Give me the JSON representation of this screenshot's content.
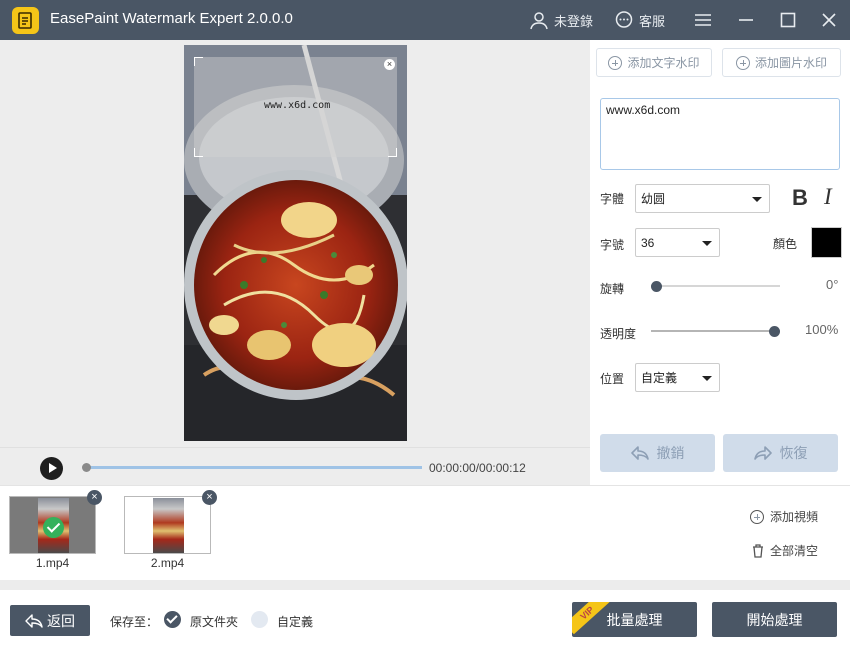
{
  "app": {
    "title": "EasePaint Watermark Expert  2.0.0.0"
  },
  "titlebar": {
    "login_label": "未登錄",
    "service_label": "客服"
  },
  "preview": {
    "watermark_text": "www.x6d.com"
  },
  "player": {
    "time": "00:00:00/00:00:12",
    "progress": 0
  },
  "panel": {
    "add_text_label": "添加文字水印",
    "add_image_label": "添加圖片水印",
    "text_value": "www.x6d.com",
    "font_label": "字體",
    "font_value": "幼圆",
    "bold_label": "B",
    "italic_label": "I",
    "size_label": "字號",
    "size_value": "36",
    "color_label": "顏色",
    "color_value": "#000000",
    "rotation_label": "旋轉",
    "rotation_value": "0°",
    "opacity_label": "透明度",
    "opacity_value": "100%",
    "position_label": "位置",
    "position_value": "自定義",
    "undo_label": "撤銷",
    "redo_label": "恢復"
  },
  "files": {
    "items": [
      {
        "name": "1.mp4",
        "selected": true
      },
      {
        "name": "2.mp4",
        "selected": false
      }
    ],
    "add_video_label": "添加視頻",
    "clear_all_label": "全部清空"
  },
  "footer": {
    "back_label": "返回",
    "save_to_label": "保存至：",
    "original_folder_label": "原文件夾",
    "custom_label": "自定義",
    "batch_label": "批量處理",
    "vip_label": "VIP",
    "start_label": "開始處理"
  },
  "colors": {
    "dark": "#4a5665",
    "accent_light": "#d0dcea",
    "check_green": "#34b15b",
    "vip_yellow": "#f5c518"
  }
}
